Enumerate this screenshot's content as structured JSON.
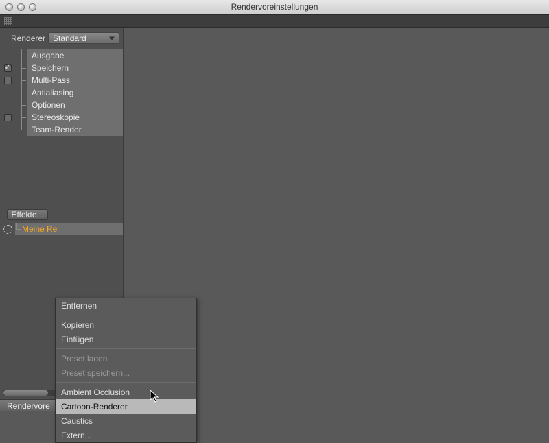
{
  "window": {
    "title": "Rendervoreinstellungen"
  },
  "renderer": {
    "label": "Renderer",
    "selected": "Standard"
  },
  "tree": [
    {
      "label": "Ausgabe",
      "checkbox": false,
      "checked": false
    },
    {
      "label": "Speichern",
      "checkbox": true,
      "checked": true
    },
    {
      "label": "Multi-Pass",
      "checkbox": true,
      "checked": false
    },
    {
      "label": "Antialiasing",
      "checkbox": false,
      "checked": false
    },
    {
      "label": "Optionen",
      "checkbox": false,
      "checked": false
    },
    {
      "label": "Stereoskopie",
      "checkbox": true,
      "checked": false
    },
    {
      "label": "Team-Render",
      "checkbox": false,
      "checked": false
    }
  ],
  "effects": {
    "button": "Effekte..."
  },
  "preset_item": {
    "label": "Meine Re"
  },
  "footer": {
    "label": "Rendervore"
  },
  "context_menu": {
    "highlighted_index": 6,
    "items": [
      {
        "label": "Entfernen",
        "type": "item",
        "enabled": true
      },
      {
        "type": "sep"
      },
      {
        "label": "Kopieren",
        "type": "item",
        "enabled": true
      },
      {
        "label": "Einfügen",
        "type": "item",
        "enabled": true
      },
      {
        "type": "sep"
      },
      {
        "label": "Preset laden",
        "type": "item",
        "enabled": false
      },
      {
        "label": "Preset speichern...",
        "type": "item",
        "enabled": false
      },
      {
        "type": "sep"
      },
      {
        "label": "Ambient Occlusion",
        "type": "item",
        "enabled": true
      },
      {
        "label": "Cartoon-Renderer",
        "type": "item",
        "enabled": true
      },
      {
        "label": "Caustics",
        "type": "item",
        "enabled": true
      },
      {
        "label": "Extern...",
        "type": "item",
        "enabled": true
      }
    ]
  }
}
